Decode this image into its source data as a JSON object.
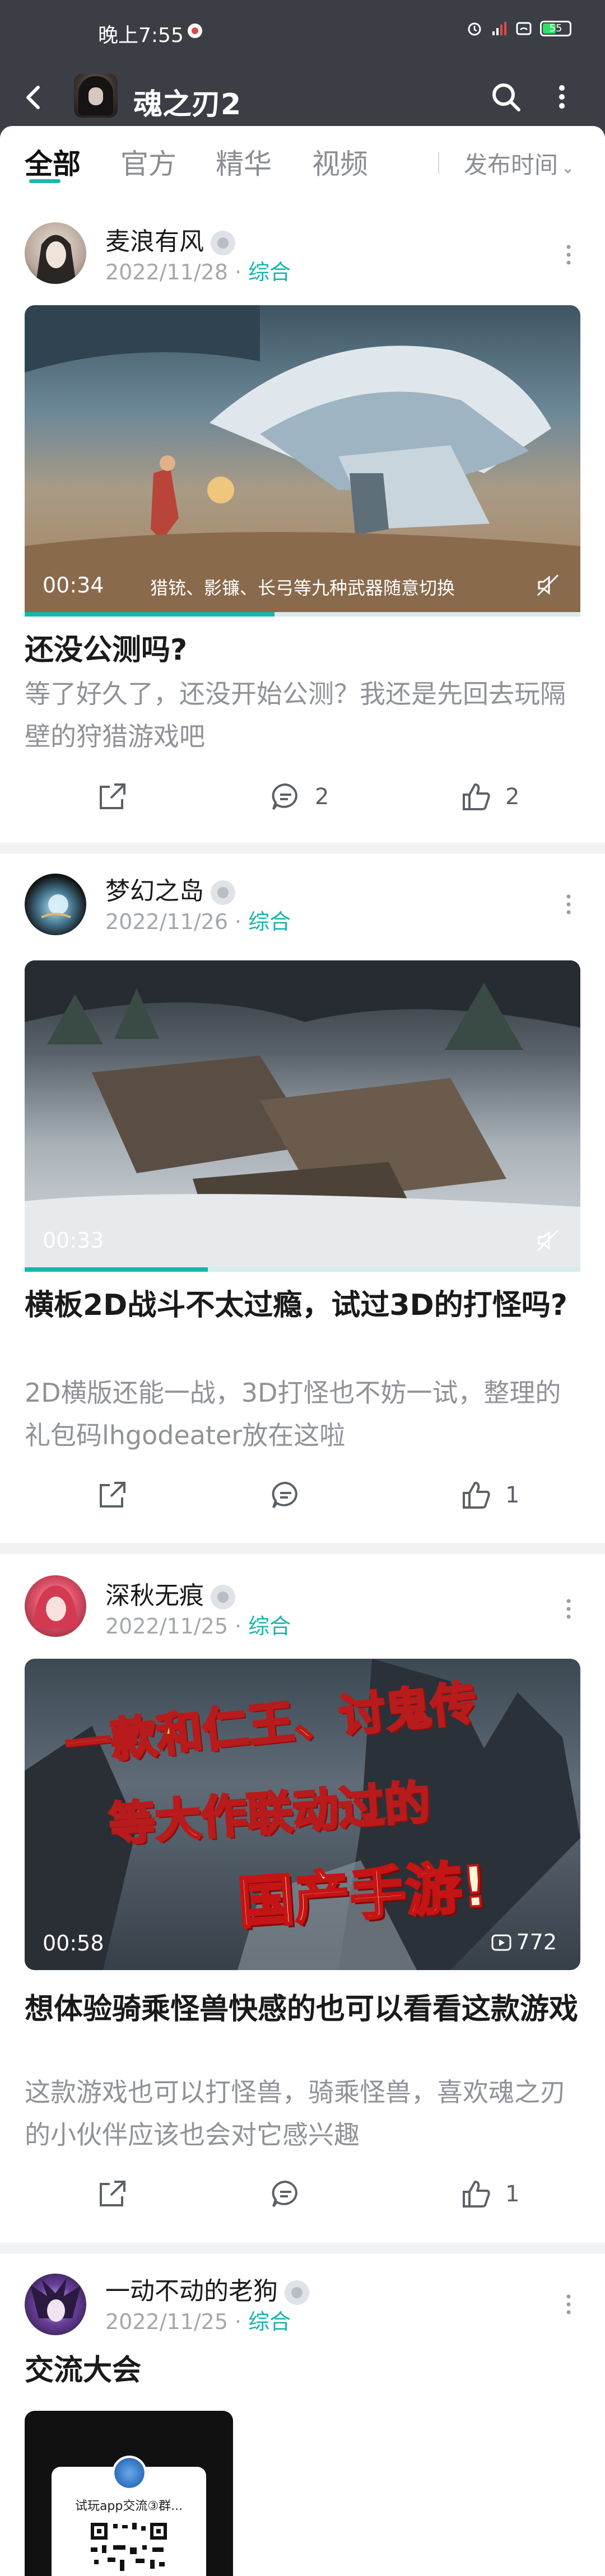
{
  "status": {
    "time": "晚上7:55",
    "battery": "55"
  },
  "header": {
    "title": "魂之刃2"
  },
  "tabs": [
    "全部",
    "官方",
    "精华",
    "视频"
  ],
  "sort_label": "发布时间",
  "posts": [
    {
      "author": "麦浪有风",
      "date": "2022/11/28",
      "category": "综合",
      "duration": "00:34",
      "caption": "猎铳、影镰、长弓等九种武器随意切换",
      "progress": 0.45,
      "title": "还没公测吗?",
      "summary": "等了好久了，还没开始公测？我还是先回去玩隔壁的狩猎游戏吧",
      "comments": "2",
      "likes": "2"
    },
    {
      "author": "梦幻之岛",
      "date": "2022/11/26",
      "category": "综合",
      "duration": "00:33",
      "caption": "",
      "progress": 0.33,
      "title": "横板2D战斗不太过瘾，试过3D的打怪吗?",
      "summary": "2D横版还能一战，3D打怪也不妨一试，整理的礼包码lhgodeater放在这啦",
      "comments": "",
      "likes": "1"
    },
    {
      "author": "深秋无痕",
      "date": "2022/11/25",
      "category": "综合",
      "duration": "00:58",
      "views": "772",
      "banner_line1": "一款和仁王、讨鬼传",
      "banner_line2": "等大作联动过的",
      "banner_line3": "国产手游!",
      "title": "想体验骑乘怪兽快感的也可以看看这款游戏",
      "summary": "这款游戏也可以打怪兽，骑乘怪兽，喜欢魂之刃的小伙伴应该也会对它感兴趣",
      "comments": "",
      "likes": "1"
    },
    {
      "author": "一动不动的老狗",
      "date": "2022/11/25",
      "category": "综合",
      "title": "交流大会",
      "image_text": "试玩app交流③群..."
    }
  ],
  "colors": {
    "accent": "#17b5ac",
    "header_bg": "#3b3f45",
    "separator": "#f1f2f4"
  }
}
